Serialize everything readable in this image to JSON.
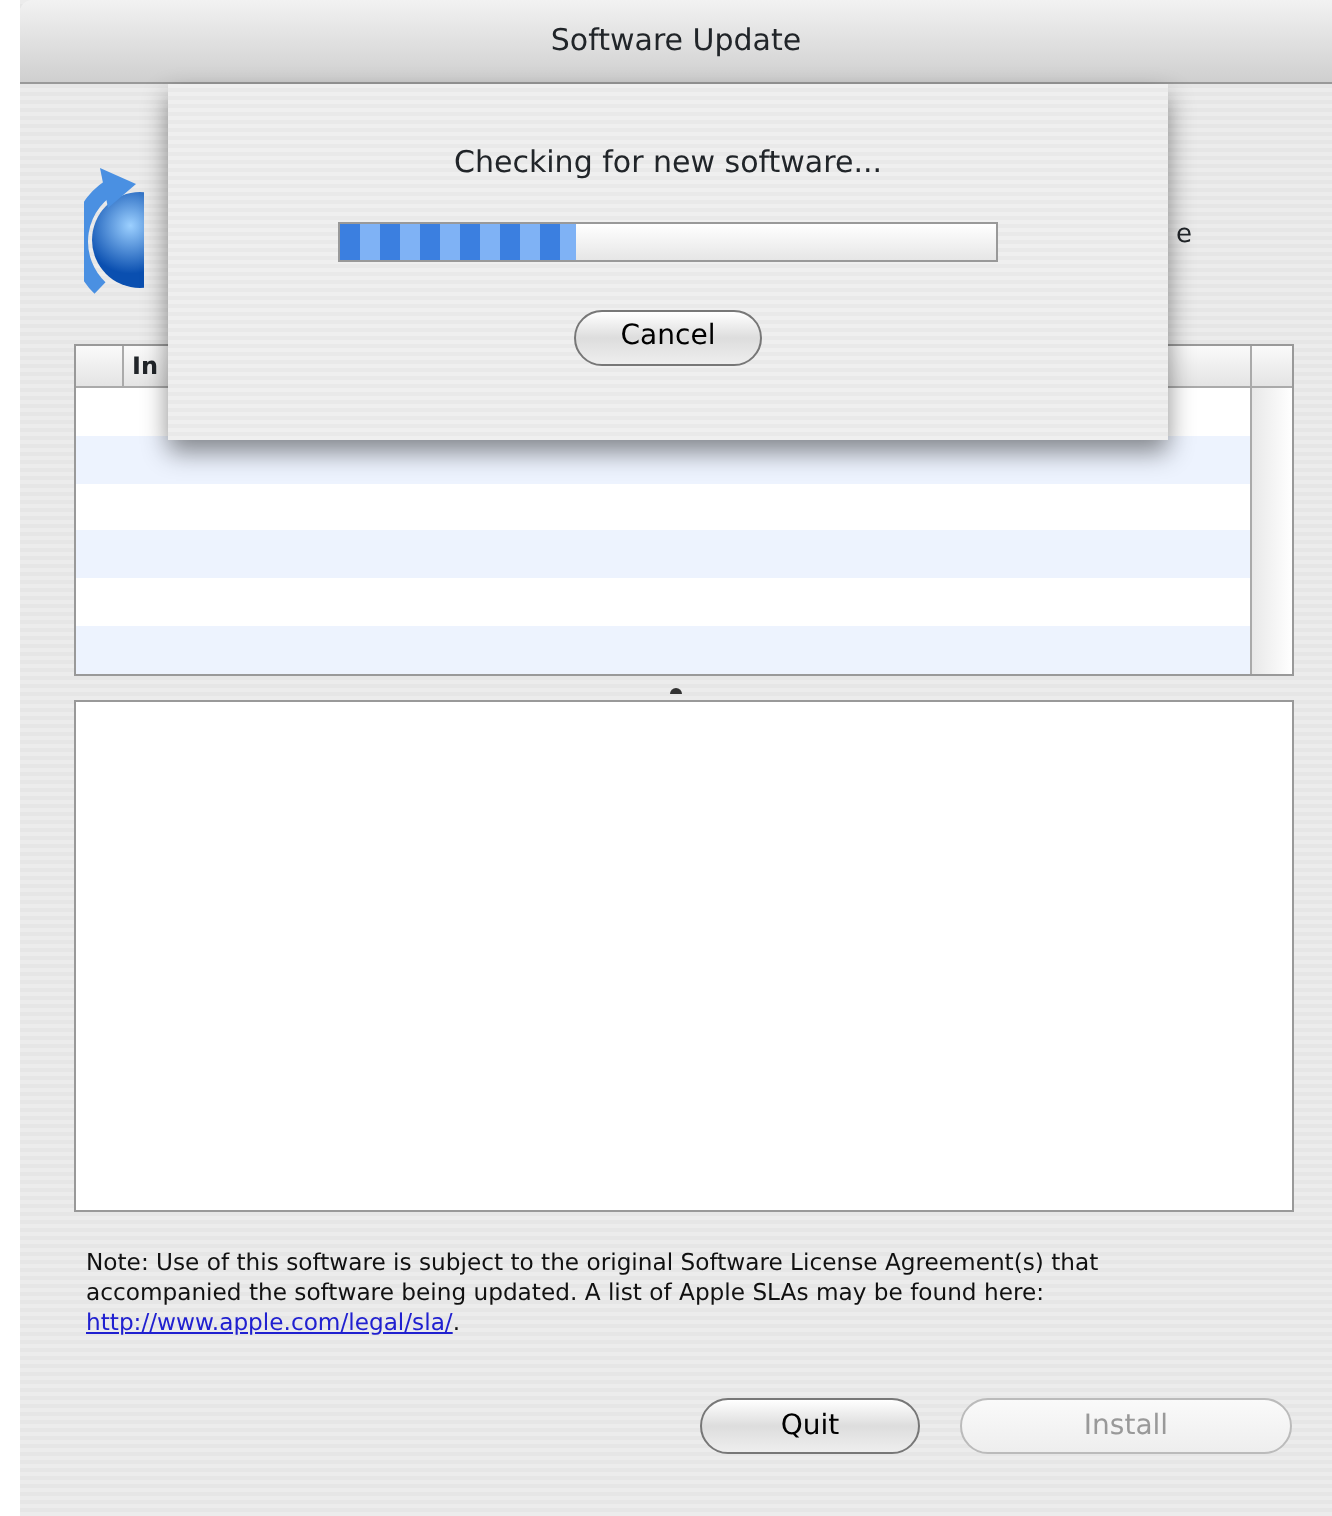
{
  "window": {
    "title": "Software Update"
  },
  "background": {
    "description_fragment": "e",
    "install_header_fragment": "In"
  },
  "sheet": {
    "message": "Checking for new software...",
    "progress": {
      "level": 0.36
    },
    "button": "Cancel"
  },
  "note": {
    "text": "Note: Use of this software is subject to the original Software License Agreement(s) that accompanied the software being updated. A list of Apple SLAs may be found here: ",
    "link": "http://www.apple.com/legal/sla/",
    "tail": "."
  },
  "buttons": [
    {
      "label": "Quit",
      "disabled": false
    },
    {
      "label": "Install",
      "disabled": true
    }
  ]
}
